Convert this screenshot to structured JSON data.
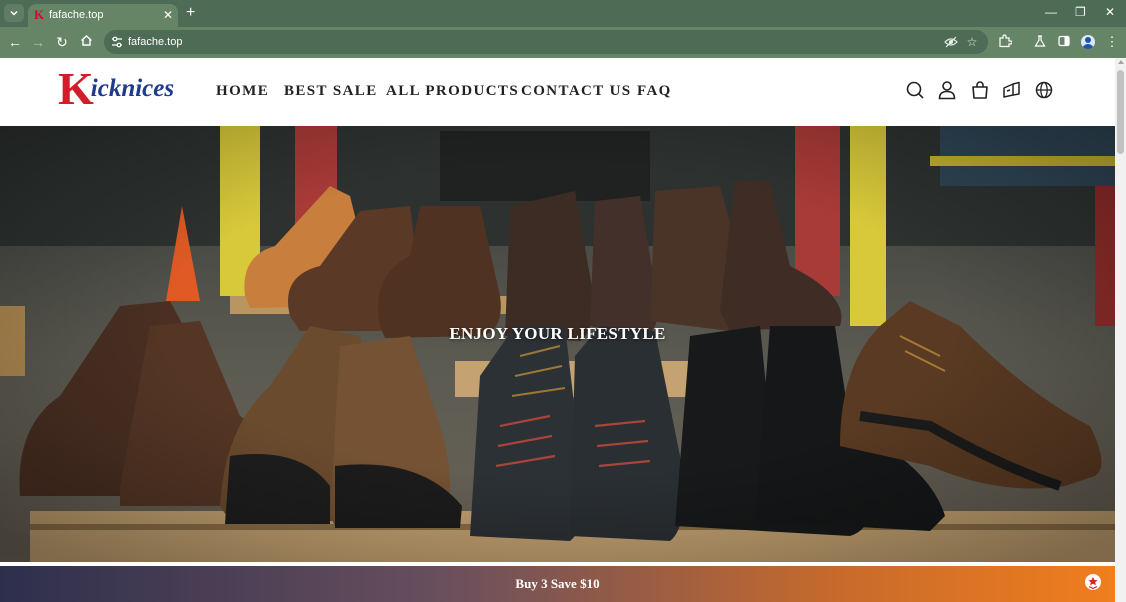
{
  "browser": {
    "tab_title": "fafache.top",
    "tab_favicon_letter": "K",
    "url": "fafache.top",
    "accent": "#4d6b55",
    "toolbar_color": "#658566"
  },
  "site": {
    "logo_k": "K",
    "logo_rest": "icknices",
    "brand_red": "#d21d28",
    "brand_blue": "#1f3a8a",
    "nav": [
      {
        "label": "HOME"
      },
      {
        "label": "BEST SALE"
      },
      {
        "label": "ALL PRODUCTS"
      },
      {
        "label": "CONTACT US"
      },
      {
        "label": "FAQ"
      }
    ],
    "header_icons": [
      "search-icon",
      "account-icon",
      "cart-icon",
      "shipping-icon",
      "language-globe-icon"
    ]
  },
  "hero": {
    "heading": "ENJOY YOUR LIFESTYLE",
    "image": "work-boots-on-pallet-photo"
  },
  "promo": {
    "text": "Buy 3 Save $10",
    "gradient_start": "#2d2f4d",
    "gradient_end": "#f07e1d"
  }
}
